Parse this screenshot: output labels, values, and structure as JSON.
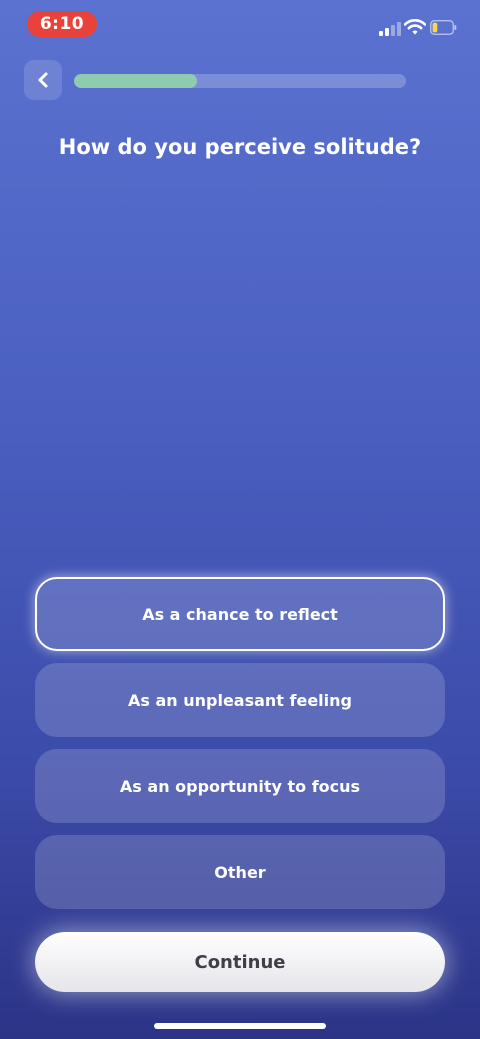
{
  "status_bar": {
    "time": "6:10",
    "icons": [
      "cellular-signal-icon",
      "wifi-icon",
      "battery-icon"
    ],
    "battery_color": "#f5d94a",
    "battery_level": 0.25
  },
  "header": {
    "back_icon": "chevron-left-icon",
    "progress": 0.37
  },
  "question": "How do you perceive solitude?",
  "options": [
    {
      "label": "As a chance to reflect",
      "selected": true
    },
    {
      "label": "As an unpleasant feeling",
      "selected": false
    },
    {
      "label": "As an opportunity to focus",
      "selected": false
    },
    {
      "label": "Other",
      "selected": false
    }
  ],
  "continue_label": "Continue",
  "colors": {
    "background_top": "#5b72d0",
    "background_bottom": "#2b3486",
    "time_pill": "#e9423b",
    "progress_fill": "#8fcbb1",
    "option_fill": "rgba(255,255,255,0.17)"
  }
}
